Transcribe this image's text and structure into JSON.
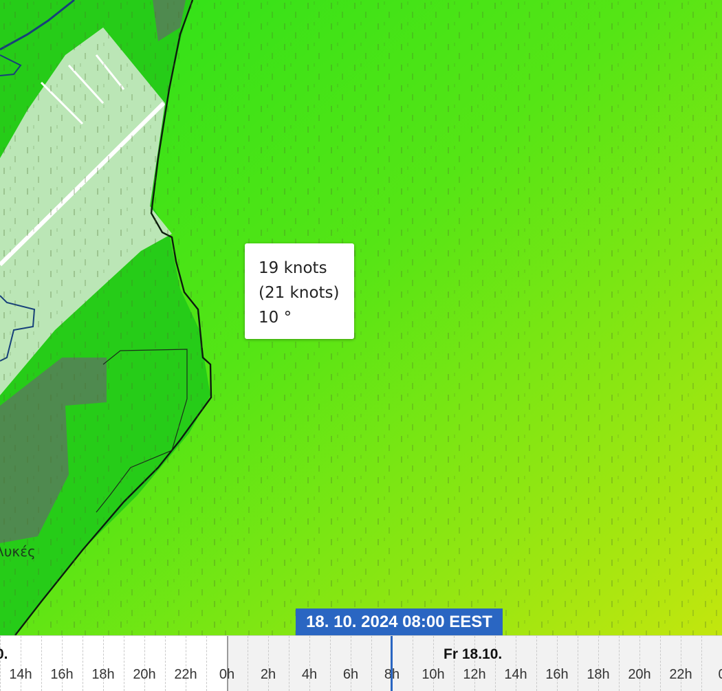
{
  "tooltip": {
    "speed": "19 knots",
    "gust": "(21 knots)",
    "direction": "10 °"
  },
  "map": {
    "place_label": "λυκές",
    "colors": {
      "sea_green": "#2ee31c",
      "sea_yellow": "#b9e60f",
      "land_dark": "#4c8a4c",
      "airport": "#d8ecd5",
      "coast": "#0d1c0d",
      "road": "#17407a"
    }
  },
  "timeline": {
    "current_time": "18. 10. 2024 08:00 EEST",
    "day_labels": {
      "prev_partial": "0.",
      "next": "Fr 18.10."
    },
    "hours": [
      "14h",
      "16h",
      "18h",
      "20h",
      "22h",
      "0h",
      "2h",
      "4h",
      "6h",
      "8h",
      "10h",
      "12h",
      "14h",
      "16h",
      "18h",
      "20h",
      "22h",
      "0"
    ]
  }
}
